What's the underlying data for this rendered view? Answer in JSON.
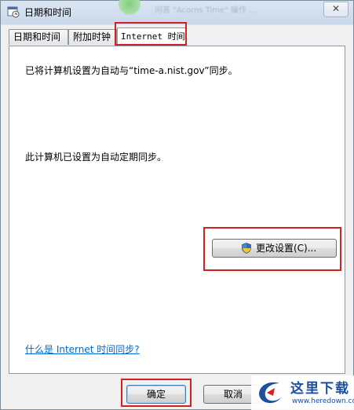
{
  "window": {
    "title": "日期和时间",
    "blurred_notification": "问答 \"Acorns Time\" 操作 ..."
  },
  "tabs": [
    {
      "label": "日期和时间",
      "active": false
    },
    {
      "label": "附加时钟",
      "active": false
    },
    {
      "label": "Internet 时间",
      "active": true
    }
  ],
  "panel": {
    "sync_status": "已将计算机设置为自动与“time-a.nist.gov”同步。",
    "auto_sync_status": "此计算机已设置为自动定期同步。",
    "change_settings_label": "更改设置(C)...",
    "help_link": "什么是 Internet 时间同步?"
  },
  "footer": {
    "ok_label": "确定",
    "cancel_label": "取消"
  },
  "watermark": {
    "site_name": "这里下载",
    "url": "www.heredown.com"
  },
  "colors": {
    "highlight": "#d42020",
    "link": "#0066cc",
    "watermark": "#1d4f9c"
  },
  "icons": {
    "title_icon": "calendar-clock-icon",
    "button_icon": "uac-shield-icon",
    "close_icon": "close-icon"
  }
}
